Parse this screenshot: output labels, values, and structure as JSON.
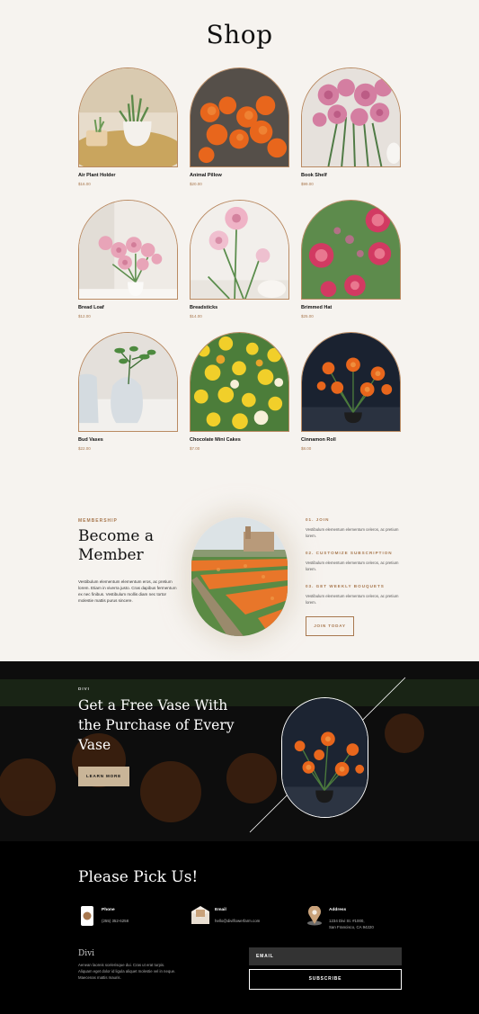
{
  "shop": {
    "title": "Shop",
    "products": [
      {
        "name": "Air Plant Holder",
        "price": "$16.00"
      },
      {
        "name": "Animal Pillow",
        "price": "$20.00"
      },
      {
        "name": "Book Shelf",
        "price": "$99.00"
      },
      {
        "name": "Bread Loaf",
        "price": "$12.00"
      },
      {
        "name": "Breadsticks",
        "price": "$14.00"
      },
      {
        "name": "Brimmed Hat",
        "price": "$25.00"
      },
      {
        "name": "Bud Vases",
        "price": "$22.00"
      },
      {
        "name": "Chocolate Mini Cakes",
        "price": "$7.00"
      },
      {
        "name": "Cinnamon Roll",
        "price": "$8.00"
      }
    ]
  },
  "membership": {
    "eyebrow": "MEMBERSHIP",
    "title": "Become a Member",
    "body": "Vestibulum elementum elementum eros, ac pretium lorem. Etiam in viverra justo. Cras dapibus fermentum ex nec finibus. Vestibulum mollis diam nec tortor molestie mattis purus sincere.",
    "steps": [
      {
        "title": "01. JOIN",
        "body": "Vestibulum elementum elementum celeros, ac pretium lorem."
      },
      {
        "title": "02. CUSTOMIZE SUBSCRIPTION",
        "body": "Vestibulum elementum elementum celeros, ac pretium lorem."
      },
      {
        "title": "03. GET WEEKLY BOUQUETS",
        "body": "Vestibulum elementum elementum celeros, ac pretium lorem."
      }
    ],
    "join_label": "JOIN TODAY"
  },
  "promo": {
    "tag": "DIVI",
    "title": "Get a Free Vase With the Purchase of Every Vase",
    "button_label": "LEARN MORE"
  },
  "contact": {
    "title": "Please Pick Us!",
    "items": [
      {
        "icon": "phone-icon",
        "label": "Phone",
        "value": "(255) 352-6258",
        "value2": ""
      },
      {
        "icon": "envelope-icon",
        "label": "Email",
        "value": "hello@diviflowerfarm.com",
        "value2": ""
      },
      {
        "icon": "map-pin-icon",
        "label": "Address",
        "value": "1234 Divi St. #1000,",
        "value2": "San Francisco, CA 94220"
      }
    ],
    "footer_brand": "Divi",
    "footer_body": "Aenean laoreis scelerisque dui. Cras ut erat turpis. Aliquam eget dolor id ligula aliquet molestie vel in neque. Maecenas mattis mauris.",
    "email_placeholder": "EMAIL",
    "subscribe_label": "SUBSCRIBE"
  },
  "colors": {
    "accent": "#a8784f",
    "cream": "#f6f3ef",
    "dark": "#0d0d0d",
    "button_tan": "#c9b598"
  }
}
